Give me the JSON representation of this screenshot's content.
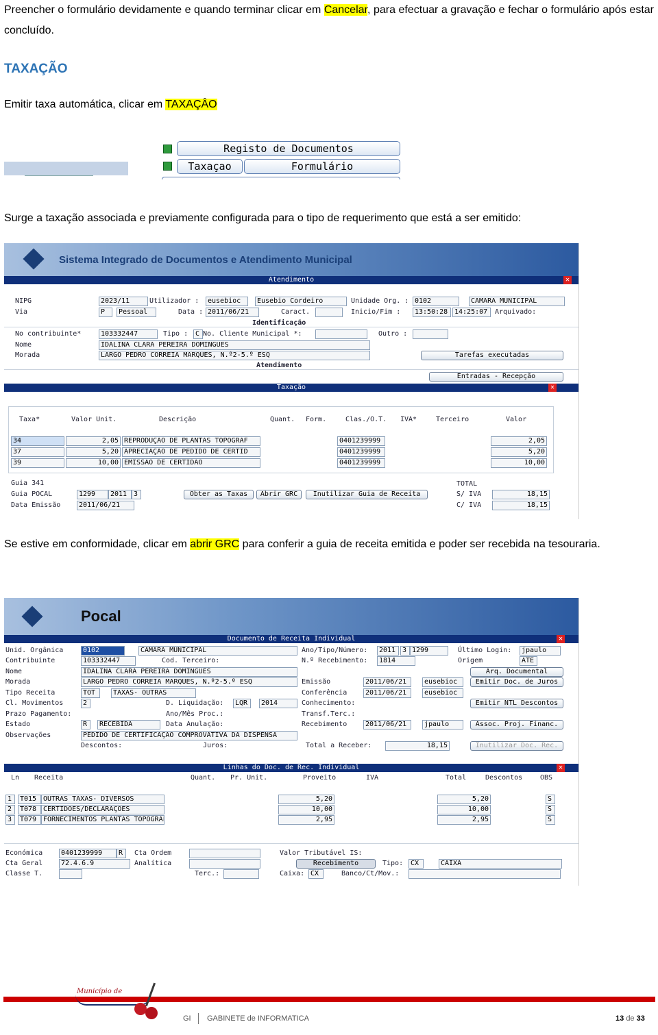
{
  "intro": {
    "before": "Preencher o formulário devidamente e quando terminar clicar em ",
    "highlight": "Cancelar",
    "after": ", para efectuar a gravação e fechar o formulário após estar concluído."
  },
  "section_title": "TAXAÇÃO",
  "step1": {
    "before": "Emitir taxa automática, clicar em ",
    "highlight": "TAXAÇÂO"
  },
  "toolbar": {
    "registo": "Registo de Documentos",
    "taxacao": "Taxaçao",
    "formulario": "Formulário"
  },
  "step2": "Surge a taxação associada e previamente configurada para o tipo de requerimento que está a ser emitido:",
  "shot1": {
    "app_title": "Sistema Integrado de Documentos e Atendimento Municipal",
    "bar_atendimento": "Atendimento",
    "nipg_label": "NIPG",
    "nipg": "2023/11",
    "utilizador_label": "Utilizador :",
    "utilizador": "eusebioc",
    "utilizador_nome": "Eusebio Cordeiro",
    "unidade_label": "Unidade Org. :",
    "unidade_cod": "0102",
    "unidade_nome": "CAMARA MUNICIPAL",
    "via_label": "Via",
    "via_cod": "P",
    "via_nome": "Pessoal",
    "data_label": "Data :",
    "data": "2011/06/21",
    "caract_label": "Caract. :",
    "inicio_label": "Inicio/Fim :",
    "inicio": "13:50:28",
    "fim": "14:25:07",
    "arquivado_label": "Arquivado:",
    "identificacao": "Identificação",
    "contrib_label": "No contribuinte*",
    "contrib": "103332447",
    "tipo_label": "Tipo :",
    "tipo": "C",
    "cliente_label": "No. Cliente Municipal *:",
    "outro_label": "Outro :",
    "nome_label": "Nome",
    "nome": "IDALINA CLARA PEREIRA DOMINGUES",
    "morada_label": "Morada",
    "morada": "LARGO PEDRO CORREIA MARQUES, N.º2-5.º ESQ",
    "tarefas": "Tarefas executadas",
    "bar_atendimento2": "Atendimento",
    "entradas": "Entradas - Recepção",
    "bar_taxacao": "Taxação",
    "cols": [
      "Taxa*",
      "Valor Unit.",
      "Descrição",
      "Quant.",
      "Form.",
      "Clas./O.T.",
      "IVA*",
      "Terceiro",
      "Valor"
    ],
    "rows": [
      {
        "taxa": "34",
        "unit": "2,05",
        "desc": "REPRODUÇÃO DE PLANTAS TOPOGRAF",
        "clas": "0401239999",
        "valor": "2,05"
      },
      {
        "taxa": "37",
        "unit": "5,20",
        "desc": "APRECIAÇÃO DE PEDIDO DE CERTID",
        "clas": "0401239999",
        "valor": "5,20"
      },
      {
        "taxa": "39",
        "unit": "10,00",
        "desc": "EMISSÃO DE CERTIDÃO",
        "clas": "0401239999",
        "valor": "10,00"
      }
    ],
    "guia341_label": "Guia 341",
    "guiapocal_label": "Guia POCAL",
    "guiapocal_num": "1299",
    "guiapocal_ano": "2011",
    "guiapocal_tipo": "3",
    "dataemissao_label": "Data Emissão",
    "dataemissao": "2011/06/21",
    "btn_obter": "Obter as Taxas",
    "btn_abrir": "Abrir GRC",
    "btn_inutilizar": "Inutilizar Guia de Receita",
    "total_label": "TOTAL",
    "siva_label": "S/ IVA",
    "siva": "18,15",
    "civa_label": "C/ IVA",
    "civa": "18,15"
  },
  "step3": {
    "before": "Se estive em conformidade, clicar em ",
    "highlight": "abrir GRC",
    "after": " para conferir a guia de receita emitida e poder ser recebida na tesouraria."
  },
  "shot2": {
    "app_title": "Pocal",
    "bar_doc": "Documento de Receita Individual",
    "unid_label": "Unid. Orgânica",
    "unid_cod": "0102",
    "unid_nome": "CAMARA MUNICIPAL",
    "contrib_label": "Contribuinte",
    "contrib": "103332447",
    "cod_terc_label": "Cod. Terceiro:",
    "nome_label": "Nome",
    "nome": "IDALINA CLARA PEREIRA DOMINGUES",
    "morada_label": "Morada",
    "morada": "LARGO PEDRO CORREIA MARQUES, N.º2-5.º ESQ",
    "tiporec_label": "Tipo Receita",
    "tiporec_cod": "TOT",
    "tiporec_nome": "TAXAS- OUTRAS",
    "clmov_label": "Cl. Movimentos",
    "clmov": "2",
    "dliq_label": "D. Liquidação:",
    "dliq_cod": "LQR",
    "dliq_ano": "2014",
    "prazo_label": "Prazo Pagamento:",
    "anomes_label": "Ano/Mês Proc.:",
    "estado_label": "Estado",
    "estado_cod": "R",
    "estado_nome": "RECEBIDA",
    "dataanul_label": "Data Anulação:",
    "obs_label": "Observações",
    "obs": "PEDIDO DE CERTIFICAÇÃO COMPROVATIVA DA DISPENSA",
    "descontos_label": "Descontos:",
    "juros_label": "Juros:",
    "anotipo_label": "Ano/Tipo/Número:",
    "ano": "2011",
    "tipo": "3",
    "numero": "1299",
    "nreceb_label": "N.º Recebimento:",
    "nreceb": "1814",
    "ultimo_label": "Último Login:",
    "ultimo": "jpaulo",
    "origem_label": "Origem",
    "origem": "ATE",
    "arq_doc": "Arq. Documental",
    "emissao_label": "Emissão",
    "emissao": "2011/06/21",
    "emissao_user": "eusebioc",
    "conferencia_label": "Conferência",
    "conferencia": "2011/06/21",
    "conferencia_user": "eusebioc",
    "conhecimento_label": "Conhecimento:",
    "transf_label": "Transf.Terc.:",
    "recebimento_label": "Recebimento",
    "recebimento": "2011/06/21",
    "recebimento_user": "jpaulo",
    "emitir_juros": "Emitir Doc. de Juros",
    "emitir_ntl": "Emitir NTL Descontos",
    "assoc": "Assoc. Proj. Financ.",
    "total_receber_label": "Total a Receber:",
    "total_receber": "18,15",
    "inutilizar": "Inutilizar Doc. Rec.",
    "bar_linhas": "Linhas do Doc. de Rec. Individual",
    "cols": [
      "Ln",
      "Receita",
      "Quant.",
      "Pr. Unit.",
      "Proveito",
      "IVA",
      "Total",
      "Descontos",
      "OBS"
    ],
    "rows": [
      {
        "ln": "1",
        "cod": "T015",
        "desc": "OUTRAS TAXAS- DIVERSOS",
        "unit": "5,20",
        "total": "5,20",
        "obs": "S"
      },
      {
        "ln": "2",
        "cod": "T078",
        "desc": "CERTIDOES/DECLARAÇÕES",
        "unit": "10,00",
        "total": "10,00",
        "obs": "S"
      },
      {
        "ln": "3",
        "cod": "T079",
        "desc": "FORNECIMENTOS PLANTAS TOPOGRAFI",
        "unit": "2,95",
        "total": "2,95",
        "obs": "S"
      }
    ],
    "economica_label": "Económica",
    "economica": "0401239999",
    "economica_r": "R",
    "ctaordem_label": "Cta Ordem",
    "ctageral_label": "Cta Geral",
    "ctageral": "72.4.6.9",
    "analitica_label": "Analítica",
    "classe_label": "Classe T.",
    "terc_label": "Terc.:",
    "valortrib_label": "Valor Tributável IS:",
    "recebimento_btn": "Recebimento",
    "tipo_label": "Tipo:",
    "tipo_cod": "CX",
    "tipo_nome": "CAIXA",
    "caixa_label": "Caixa:",
    "caixa": "CX",
    "banco_label": "Banco/Ct/Mov.:"
  },
  "footer": {
    "logo_text": "Município de",
    "gi": "GI",
    "dept": "GABINETE de INFORMATICA",
    "page": "13",
    "de": "de",
    "total": "33"
  }
}
